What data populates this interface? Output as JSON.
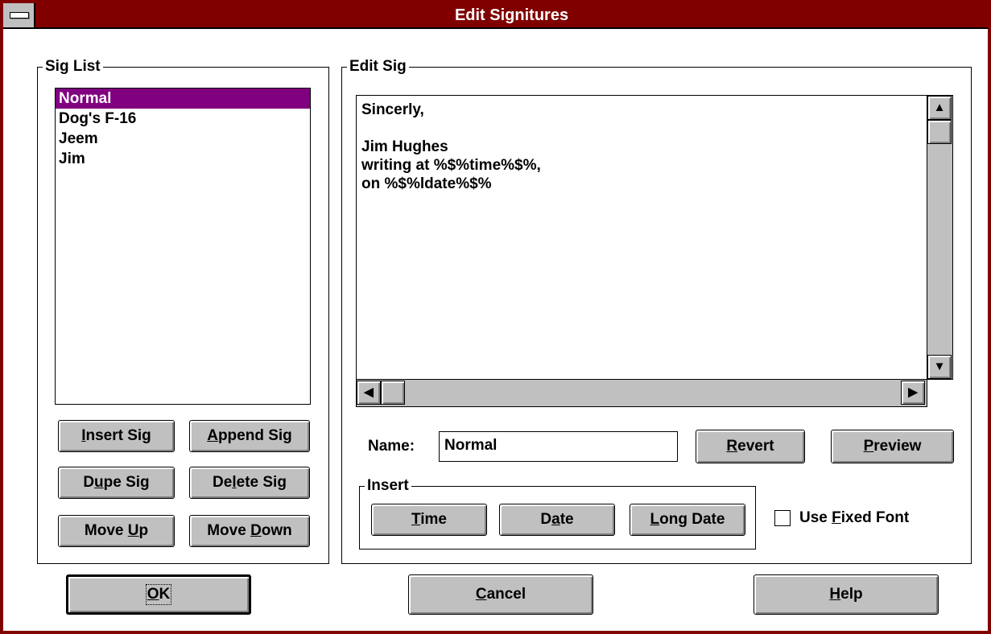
{
  "window": {
    "title": "Edit Signitures"
  },
  "sig_list": {
    "label": "Sig List",
    "items": [
      "Normal",
      "Dog's F-16",
      "Jeem",
      "Jim"
    ],
    "selected_index": 0,
    "buttons": {
      "insert_sig": {
        "pre": "",
        "key": "I",
        "post": "nsert Sig"
      },
      "append_sig": {
        "pre": "",
        "key": "A",
        "post": "ppend Sig"
      },
      "dupe_sig": {
        "pre": "D",
        "key": "u",
        "post": "pe Sig"
      },
      "delete_sig": {
        "pre": "De",
        "key": "l",
        "post": "ete Sig"
      },
      "move_up": {
        "pre": "Move ",
        "key": "U",
        "post": "p"
      },
      "move_down": {
        "pre": "Move ",
        "key": "D",
        "post": "own"
      }
    }
  },
  "edit_sig": {
    "label": "Edit Sig",
    "text": "Sincerly,\n\nJim Hughes\nwriting at %$%time%$%,\non %$%ldate%$%",
    "name_label": "Name:",
    "name_value": "Normal",
    "revert": {
      "pre": "",
      "key": "R",
      "post": "evert"
    },
    "preview": {
      "pre": "",
      "key": "P",
      "post": "review"
    },
    "insert_group_label": "Insert",
    "time": {
      "pre": "",
      "key": "T",
      "post": "ime"
    },
    "date": {
      "pre": "D",
      "key": "a",
      "post": "te"
    },
    "long_date": {
      "pre": "",
      "key": "L",
      "post": "ong Date"
    },
    "fixed_font": {
      "pre": "Use ",
      "key": "F",
      "post": "ixed Font",
      "checked": false
    }
  },
  "footer": {
    "ok": {
      "pre": "",
      "key": "O",
      "post": "K"
    },
    "cancel": {
      "pre": "",
      "key": "C",
      "post": "ancel"
    },
    "help": {
      "pre": "",
      "key": "H",
      "post": "elp"
    }
  },
  "icons": {
    "system_menu": "system-menu-icon",
    "scroll_up": "arrow-up-icon",
    "scroll_down": "arrow-down-icon",
    "scroll_left": "arrow-left-icon",
    "scroll_right": "arrow-right-icon"
  },
  "colors": {
    "titlebar": "#800000",
    "selection": "#800080",
    "button_face": "#c0c0c0"
  }
}
